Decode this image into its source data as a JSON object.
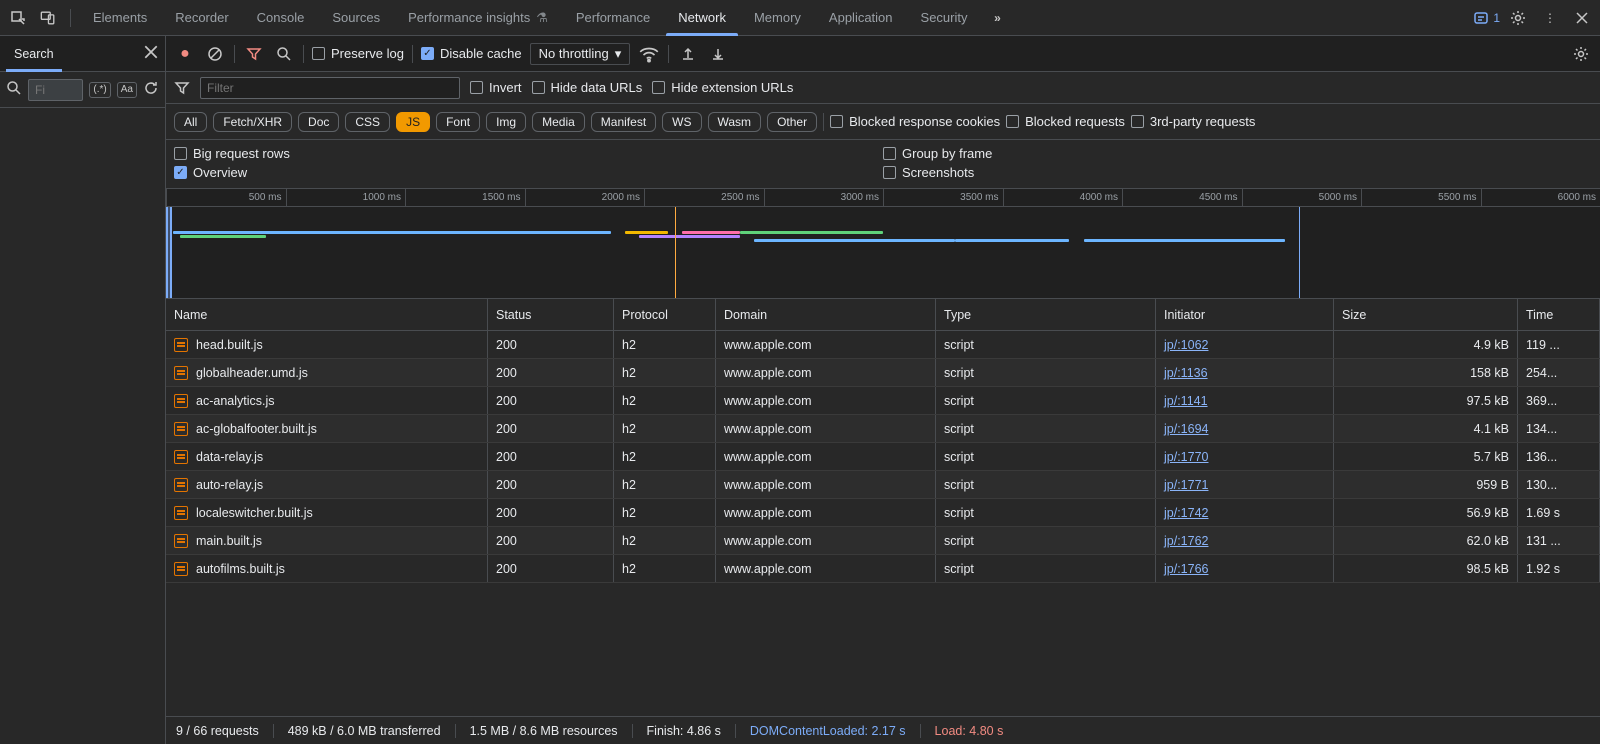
{
  "top_tabs": {
    "items": [
      "Elements",
      "Recorder",
      "Console",
      "Sources",
      "Performance insights",
      "Performance",
      "Network",
      "Memory",
      "Application",
      "Security"
    ],
    "active_index": 6,
    "issues_count": "1"
  },
  "drawer": {
    "tab_label": "Search",
    "search_placeholder": "Fi",
    "regex_label": "(.*)",
    "case_label": "Aa"
  },
  "net_toolbar": {
    "preserve_log": "Preserve log",
    "disable_cache": "Disable cache",
    "throttling": "No throttling"
  },
  "filter_bar": {
    "filter_placeholder": "Filter",
    "invert": "Invert",
    "hide_data_urls": "Hide data URLs",
    "hide_ext_urls": "Hide extension URLs"
  },
  "type_chips": [
    "All",
    "Fetch/XHR",
    "Doc",
    "CSS",
    "JS",
    "Font",
    "Img",
    "Media",
    "Manifest",
    "WS",
    "Wasm",
    "Other"
  ],
  "type_chip_active_index": 4,
  "type_extras": {
    "blocked_cookies": "Blocked response cookies",
    "blocked_requests": "Blocked requests",
    "third_party": "3rd-party requests"
  },
  "opt_row": {
    "big_rows": "Big request rows",
    "overview": "Overview",
    "group_frame": "Group by frame",
    "screenshots": "Screenshots"
  },
  "timeline": {
    "ticks": [
      "500 ms",
      "1000 ms",
      "1500 ms",
      "2000 ms",
      "2500 ms",
      "3000 ms",
      "3500 ms",
      "4000 ms",
      "4500 ms",
      "5000 ms",
      "5500 ms",
      "6000 ms"
    ]
  },
  "columns": [
    "Name",
    "Status",
    "Protocol",
    "Domain",
    "Type",
    "Initiator",
    "Size",
    "Time"
  ],
  "rows": [
    {
      "name": "head.built.js",
      "status": "200",
      "protocol": "h2",
      "domain": "www.apple.com",
      "type": "script",
      "initiator": "jp/:1062",
      "size": "4.9 kB",
      "time": "119 ..."
    },
    {
      "name": "globalheader.umd.js",
      "status": "200",
      "protocol": "h2",
      "domain": "www.apple.com",
      "type": "script",
      "initiator": "jp/:1136",
      "size": "158 kB",
      "time": "254..."
    },
    {
      "name": "ac-analytics.js",
      "status": "200",
      "protocol": "h2",
      "domain": "www.apple.com",
      "type": "script",
      "initiator": "jp/:1141",
      "size": "97.5 kB",
      "time": "369..."
    },
    {
      "name": "ac-globalfooter.built.js",
      "status": "200",
      "protocol": "h2",
      "domain": "www.apple.com",
      "type": "script",
      "initiator": "jp/:1694",
      "size": "4.1 kB",
      "time": "134..."
    },
    {
      "name": "data-relay.js",
      "status": "200",
      "protocol": "h2",
      "domain": "www.apple.com",
      "type": "script",
      "initiator": "jp/:1770",
      "size": "5.7 kB",
      "time": "136..."
    },
    {
      "name": "auto-relay.js",
      "status": "200",
      "protocol": "h2",
      "domain": "www.apple.com",
      "type": "script",
      "initiator": "jp/:1771",
      "size": "959 B",
      "time": "130..."
    },
    {
      "name": "localeswitcher.built.js",
      "status": "200",
      "protocol": "h2",
      "domain": "www.apple.com",
      "type": "script",
      "initiator": "jp/:1742",
      "size": "56.9 kB",
      "time": "1.69 s"
    },
    {
      "name": "main.built.js",
      "status": "200",
      "protocol": "h2",
      "domain": "www.apple.com",
      "type": "script",
      "initiator": "jp/:1762",
      "size": "62.0 kB",
      "time": "131 ..."
    },
    {
      "name": "autofilms.built.js",
      "status": "200",
      "protocol": "h2",
      "domain": "www.apple.com",
      "type": "script",
      "initiator": "jp/:1766",
      "size": "98.5 kB",
      "time": "1.92 s"
    }
  ],
  "status": {
    "requests": "9 / 66 requests",
    "transferred": "489 kB / 6.0 MB transferred",
    "resources": "1.5 MB / 8.6 MB resources",
    "finish": "Finish: 4.86 s",
    "dcl": "DOMContentLoaded: 2.17 s",
    "load": "Load: 4.80 s"
  },
  "colors": {
    "accent": "#7cacf8",
    "link": "#8ab4f8",
    "orange": "#e37400",
    "red": "#f28b82"
  }
}
